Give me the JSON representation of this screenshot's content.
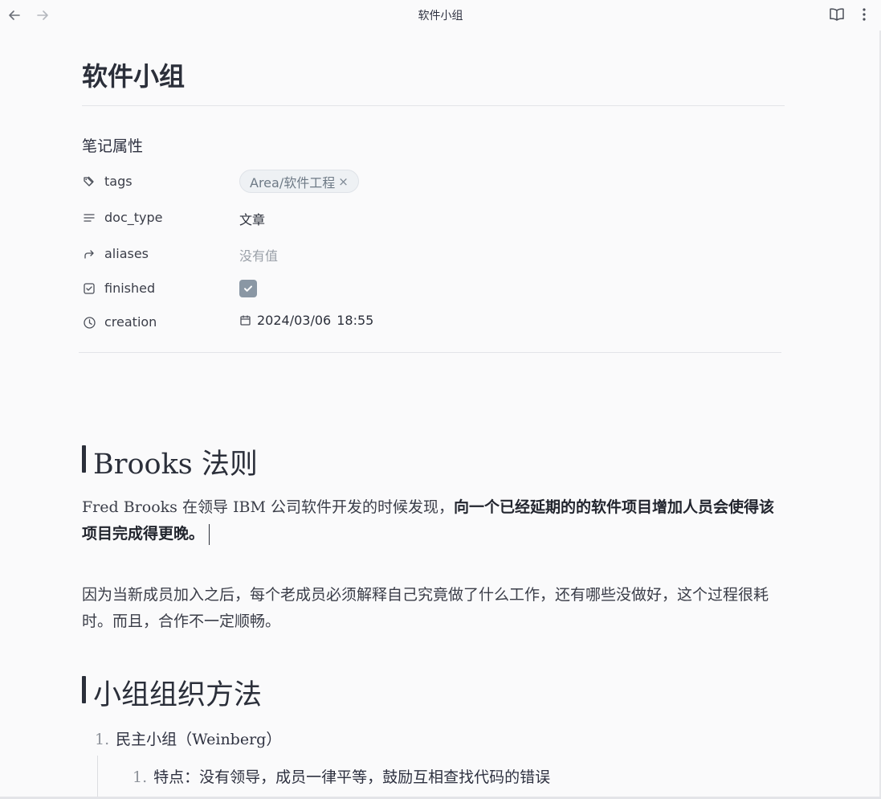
{
  "window": {
    "title": "软件小组"
  },
  "note": {
    "title": "软件小组"
  },
  "properties": {
    "heading": "笔记属性",
    "tags": {
      "key": "tags",
      "value": "Area/软件工程",
      "remove": "×"
    },
    "doc_type": {
      "key": "doc_type",
      "value": "文章"
    },
    "aliases": {
      "key": "aliases",
      "value": "没有值"
    },
    "finished": {
      "key": "finished",
      "checked": true
    },
    "creation": {
      "key": "creation",
      "date": "2024/03/06",
      "time": "18:55"
    }
  },
  "content": {
    "h1_brooks": "Brooks 法则",
    "p1_normal": "Fred Brooks 在领导 IBM 公司软件开发的时候发现，",
    "p1_bold": "向一个已经延期的的软件项目增加人员会使得该项目完成得更晚。",
    "p2": "因为当新成员加入之后，每个老成员必须解释自己究竟做了什么工作，还有哪些没做好，这个过程很耗时。而且，合作不一定顺畅。",
    "h1_org": "小组组织方法",
    "list1_num": "1.",
    "list1_text": "民主小组（Weinberg）",
    "list2_num": "1.",
    "list2_text": "特点：没有领导，成员一律平等，鼓励互相查找代码的错误"
  },
  "colors": {
    "accent": "#8a97a4",
    "text": "#2b2f3a",
    "muted": "#9aa0a8"
  }
}
